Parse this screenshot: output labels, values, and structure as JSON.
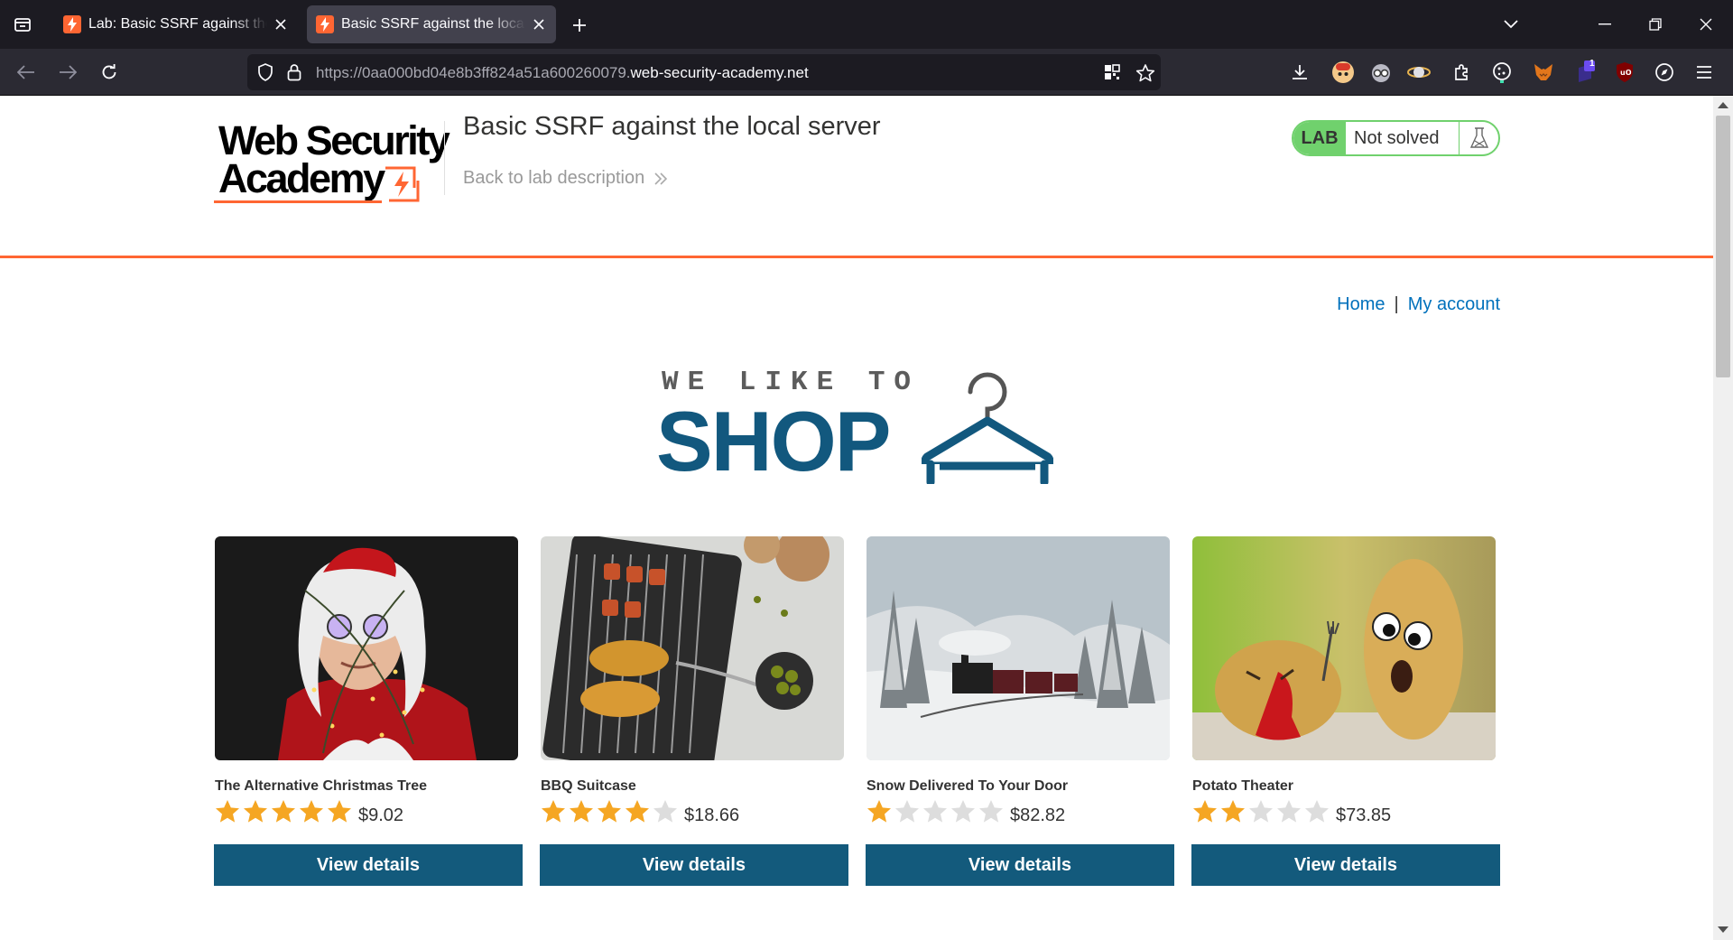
{
  "browser": {
    "tabs": [
      {
        "title": "Lab: Basic SSRF against the local server",
        "active": false
      },
      {
        "title": "Basic SSRF against the local server",
        "active": true
      }
    ],
    "url_prefix": "https://0aa000bd04e8b3ff824a51a600260079.",
    "url_domain": "web-security-academy.net",
    "extension_badge": "1"
  },
  "header": {
    "logo_line1": "Web Security",
    "logo_line2": "Academy",
    "lab_title": "Basic SSRF against the local server",
    "back_link": "Back to lab description",
    "status_tag": "LAB",
    "status_text": "Not solved"
  },
  "nav": {
    "home": "Home",
    "separator": "|",
    "account": "My account"
  },
  "banner": {
    "tagline": "WE LIKE TO",
    "headline": "SHOP"
  },
  "products": [
    {
      "name": "The Alternative Christmas Tree",
      "rating": 5,
      "price": "$9.02",
      "button": "View details"
    },
    {
      "name": "BBQ Suitcase",
      "rating": 4,
      "price": "$18.66",
      "button": "View details"
    },
    {
      "name": "Snow Delivered To Your Door",
      "rating": 1,
      "price": "$82.82",
      "button": "View details"
    },
    {
      "name": "Potato Theater",
      "rating": 2,
      "price": "$73.85",
      "button": "View details"
    }
  ],
  "colors": {
    "accent_orange": "#ff6633",
    "lab_green": "#70d16d",
    "button_blue": "#135a7c",
    "link_blue": "#0071bc",
    "star_gold": "#f5a623",
    "star_empty": "#dddddd"
  }
}
